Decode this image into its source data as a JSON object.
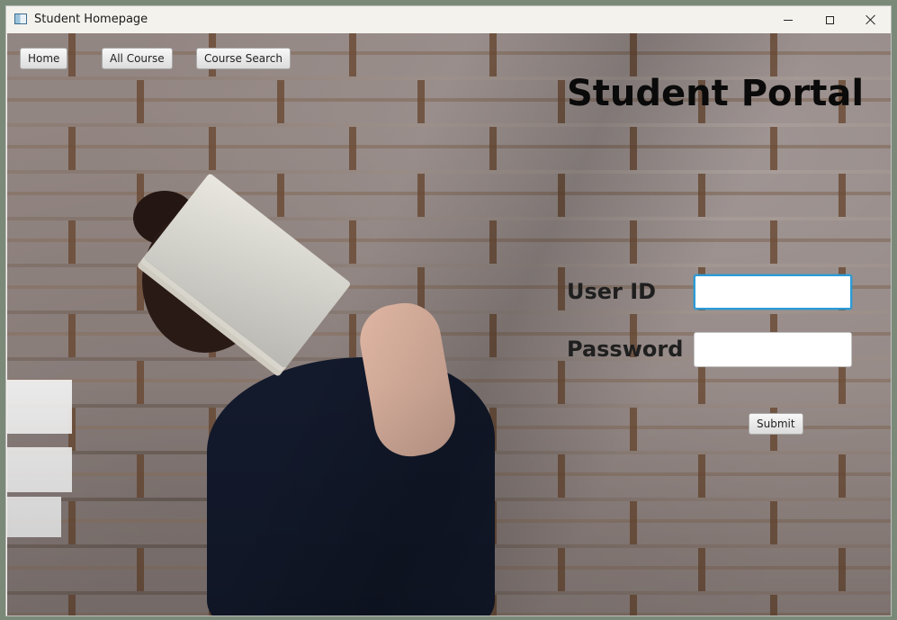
{
  "window": {
    "title": "Student Homepage",
    "icon": "app-window-icon",
    "controls": [
      "minimize-icon",
      "maximize-icon",
      "close-icon"
    ]
  },
  "nav": {
    "home_label": "Home",
    "all_course_label": "All Course",
    "course_search_label": "Course Search"
  },
  "portal": {
    "title": "Student Portal"
  },
  "login_form": {
    "user_id_label": "User ID",
    "user_id_value": "",
    "password_label": "Password",
    "password_value": "",
    "submit_label": "Submit",
    "focused_field": "user_id"
  },
  "colors": {
    "focus_accent": "#2b9bd6",
    "title_text": "#0a0a0a"
  }
}
